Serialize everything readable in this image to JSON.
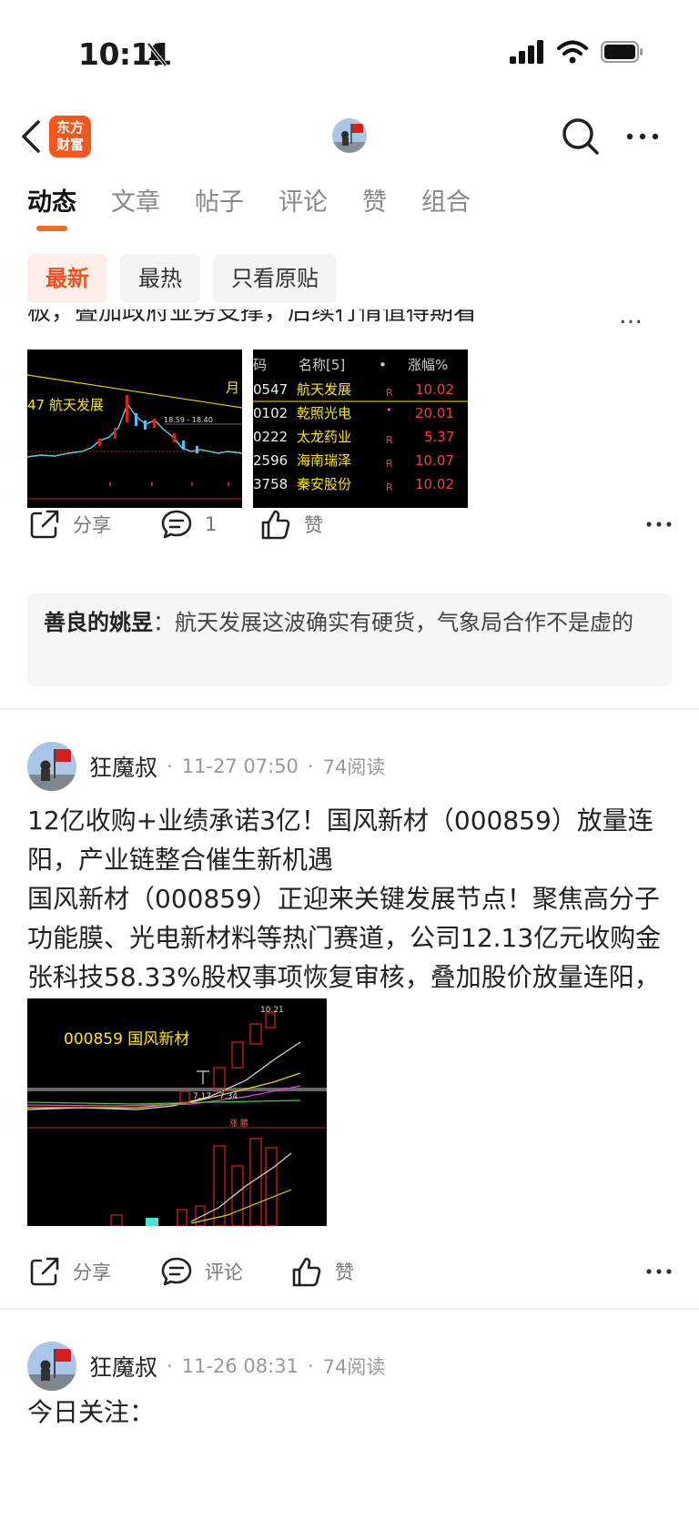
{
  "status": {
    "time": "10:11"
  },
  "app": {
    "logo_line1": "东方",
    "logo_line2": "财富"
  },
  "tabs": [
    {
      "label": "动态",
      "active": true
    },
    {
      "label": "文章",
      "active": false
    },
    {
      "label": "帖子",
      "active": false
    },
    {
      "label": "评论",
      "active": false
    },
    {
      "label": "赞",
      "active": false
    },
    {
      "label": "组合",
      "active": false
    }
  ],
  "filters": [
    {
      "label": "最新",
      "active": true
    },
    {
      "label": "最热",
      "active": false
    },
    {
      "label": "只看原贴",
      "active": false
    }
  ],
  "post1": {
    "text_partial": "板，叠加政府业务支撑，后续行情值得期看",
    "more": "…",
    "image1": {
      "label": "47 航天发展",
      "corner": "月",
      "range": "18.59 - 18.40"
    },
    "image2": {
      "headers": [
        "码",
        "名称[5]",
        "•",
        "涨幅%"
      ],
      "rows": [
        {
          "code": "0547",
          "name": "航天发展",
          "flag": "R",
          "change": "10.02"
        },
        {
          "code": "0102",
          "name": "乾照光电",
          "flag": "•",
          "change": "20.01"
        },
        {
          "code": "0222",
          "name": "太龙药业",
          "flag": "R",
          "change": "5.37"
        },
        {
          "code": "2596",
          "name": "海南瑞泽",
          "flag": "R",
          "change": "10.07"
        },
        {
          "code": "3758",
          "name": "秦安股份",
          "flag": "R",
          "change": "10.02"
        }
      ]
    },
    "actions": {
      "share": "分享",
      "comment": "1",
      "like": "赞"
    },
    "comment": {
      "user": "善良的姚昱",
      "sep": "：",
      "text": "航天发展这波确实有硬货，气象局合作不是虚的"
    }
  },
  "post2": {
    "author": "狂魔叔",
    "date": "11-27 07:50",
    "reads": "74阅读",
    "body": "12亿收购+业绩承诺3亿！国风新材（000859）放量连阳，产业链整合催生新机遇\n国风新材（000859）正迎来关键发展节点！聚焦高分子功能膜、光电新材料等热门赛道，公司12.13亿元收购金张科技58.33%股权事项恢复审核，叠加股价放量连阳，成长潜力凸显！...",
    "image": {
      "label": "000859 国风新材",
      "high": "10.21",
      "range": "7.17 - 7.34",
      "tag": "涨 鹏"
    },
    "actions": {
      "share": "分享",
      "comment": "评论",
      "like": "赞"
    }
  },
  "post3": {
    "author": "狂魔叔",
    "date": "11-26 08:31",
    "reads": "74阅读",
    "body_partial": "今日关注："
  },
  "colors": {
    "accent": "#f4511e",
    "logo": "#f5561b",
    "chart_bg": "#000000"
  }
}
